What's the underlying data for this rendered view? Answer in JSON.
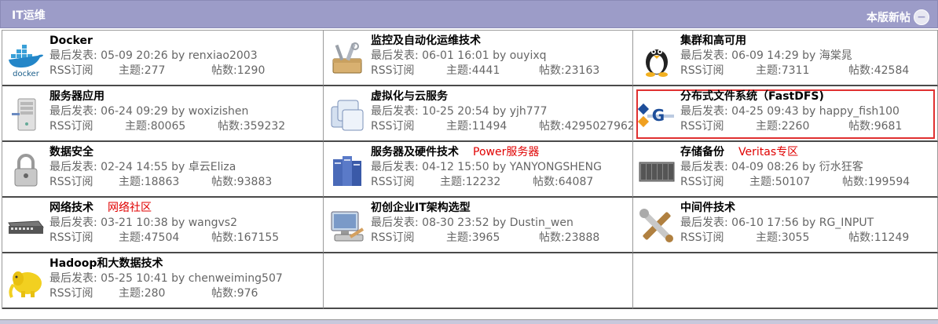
{
  "header": {
    "title": "IT运维",
    "newpost": "本版新帖",
    "newpost_icon": "−"
  },
  "labels": {
    "last": "最后发表: ",
    "by": " by ",
    "rss": "RSS订阅",
    "topics": "主题: ",
    "posts": "帖数: "
  },
  "forums": [
    {
      "name": "Docker",
      "sub": "",
      "date": "05-09 20:26",
      "user": "renxiao2003",
      "topics": "277",
      "posts": "1290",
      "icon": "docker-icon"
    },
    {
      "name": "监控及自动化运维技术",
      "sub": "",
      "date": "06-01 16:01",
      "user": "ouyixq",
      "topics": "4441",
      "posts": "23163",
      "icon": "toolbox-icon"
    },
    {
      "name": "集群和高可用",
      "sub": "",
      "date": "06-09 14:29",
      "user": "海棠晁",
      "topics": "7311",
      "posts": "42584",
      "icon": "penguin-icon"
    },
    {
      "name": "服务器应用",
      "sub": "",
      "date": "06-24 09:29",
      "user": "woxizishen",
      "topics": "80065",
      "posts": "359232",
      "icon": "server-icon"
    },
    {
      "name": "虚拟化与云服务",
      "sub": "",
      "date": "10-25 20:54",
      "user": "yjh777",
      "topics": "11494",
      "posts": "4295027962",
      "icon": "virtual-icon"
    },
    {
      "name": "分布式文件系统（FastDFS)",
      "sub": "",
      "date": "04-25 09:43",
      "user": "happy_fish100",
      "topics": "2260",
      "posts": "9681",
      "icon": "fastdfs-icon",
      "highlight": true
    },
    {
      "name": "数据安全",
      "sub": "",
      "date": "02-24 14:55",
      "user": "卓云Eliza",
      "topics": "18863",
      "posts": "93883",
      "icon": "lock-icon"
    },
    {
      "name": "服务器及硬件技术",
      "sub": "Power服务器",
      "date": "04-12 15:50",
      "user": "YANYONGSHENG",
      "topics": "12232",
      "posts": "64087",
      "icon": "rack-icon"
    },
    {
      "name": "存储备份",
      "sub": "Veritas专区",
      "date": "04-09 08:26",
      "user": "衍水狂客",
      "topics": "50107",
      "posts": "199594",
      "icon": "storage-icon"
    },
    {
      "name": "网络技术",
      "sub": "网络社区",
      "date": "03-21 10:38",
      "user": "wangvs2",
      "topics": "47504",
      "posts": "167155",
      "icon": "switch-icon"
    },
    {
      "name": "初创企业IT架构选型",
      "sub": "",
      "date": "08-30 23:52",
      "user": "Dustin_wen",
      "topics": "3965",
      "posts": "23888",
      "icon": "computer-icon"
    },
    {
      "name": "中间件技术",
      "sub": "",
      "date": "06-10 17:56",
      "user": "RG_INPUT",
      "topics": "3055",
      "posts": "11249",
      "icon": "tools-icon"
    },
    {
      "name": "Hadoop和大数据技术",
      "sub": "",
      "date": "05-25 10:41",
      "user": "chenweiming507",
      "topics": "280",
      "posts": "976",
      "icon": "hadoop-icon"
    }
  ],
  "colors": {
    "header_bg": "#9c9cc8",
    "sub_red": "#e00000",
    "highlight": "#e03030"
  }
}
